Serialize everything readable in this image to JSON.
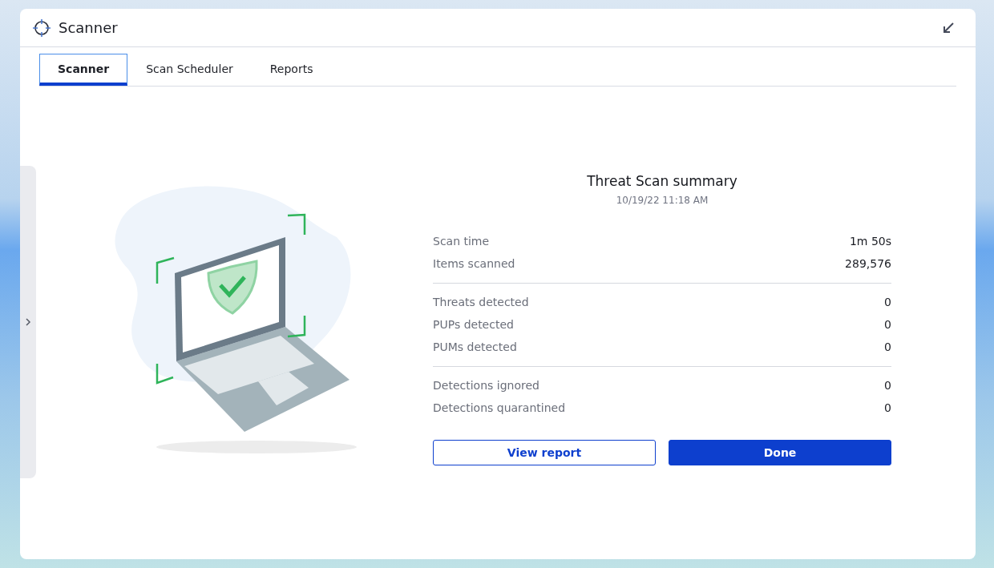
{
  "window": {
    "title": "Scanner"
  },
  "tabs": [
    {
      "label": "Scanner",
      "selected": true
    },
    {
      "label": "Scan Scheduler",
      "selected": false
    },
    {
      "label": "Reports",
      "selected": false
    }
  ],
  "summary": {
    "title": "Threat Scan summary",
    "date": "10/19/22 11:18 AM",
    "groups": [
      [
        {
          "label": "Scan time",
          "value": "1m 50s"
        },
        {
          "label": "Items scanned",
          "value": "289,576"
        }
      ],
      [
        {
          "label": "Threats detected",
          "value": "0"
        },
        {
          "label": "PUPs detected",
          "value": "0"
        },
        {
          "label": "PUMs detected",
          "value": "0"
        }
      ],
      [
        {
          "label": "Detections ignored",
          "value": "0"
        },
        {
          "label": "Detections quarantined",
          "value": "0"
        }
      ]
    ]
  },
  "buttons": [
    {
      "label": "View report",
      "kind": "secondary"
    },
    {
      "label": "Done",
      "kind": "primary"
    }
  ]
}
